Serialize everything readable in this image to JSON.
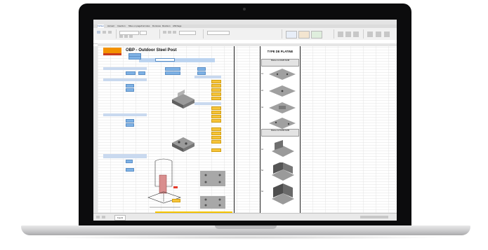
{
  "excel": {
    "ribbon_tabs": [
      "Fichier",
      "Accueil",
      "Insertion",
      "Mise en page",
      "Formules",
      "Données",
      "Révision",
      "Affichage"
    ],
    "sheet_tabs": [
      "Feuil1"
    ]
  },
  "form": {
    "title": "OBP - Outdoor Steel Post",
    "right_header": "TYPE DE PLATINE",
    "platine_group1": "Platines 1A 2A/2B 3A/3B",
    "platine_group2": "Platines 4A 5A/5B 6A/6B",
    "codes": [
      "1A",
      "2A",
      "3A",
      "4A",
      "5A",
      "6A"
    ]
  },
  "colors": {
    "section_header": "#c9d9ef",
    "input_blue": "#7fb2e5",
    "input_yellow": "#f6c43a",
    "logo_orange": "#f39200"
  }
}
